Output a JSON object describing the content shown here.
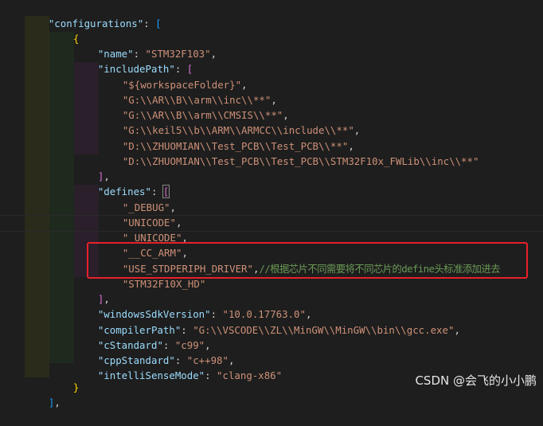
{
  "lines": [
    [
      "\"configurations\"",
      ": ",
      "["
    ],
    [
      "{"
    ],
    [
      "\"name\"",
      ": ",
      "\"STM32F103\"",
      ","
    ],
    [
      "\"includePath\"",
      ": ",
      "["
    ],
    [
      "\"${workspaceFolder}\"",
      ","
    ],
    [
      "\"G:\\\\AR\\\\B\\\\arm\\\\inc\\\\**\"",
      ","
    ],
    [
      "\"G:\\\\AR\\\\B\\\\arm\\\\CMSIS\\\\**\"",
      ","
    ],
    [
      "\"G:\\\\keil5\\\\b\\\\ARM\\\\ARMCC\\\\include\\\\**\"",
      ","
    ],
    [
      "\"D:\\\\ZHUOMIAN\\\\Test_PCB\\\\Test_PCB\\\\**\"",
      ","
    ],
    [
      "\"D:\\\\ZHUOMIAN\\\\Test_PCB\\\\Test_PCB\\\\STM32F10x_FWLib\\\\inc\\\\**\""
    ],
    [
      "]",
      ","
    ],
    [
      "\"defines\"",
      ": ",
      "["
    ],
    [
      "\"_DEBUG\"",
      ","
    ],
    [
      "\"UNICODE\"",
      ","
    ],
    [
      "\"_UNICODE\"",
      ","
    ],
    [
      "\"__CC_ARM\"",
      ","
    ],
    [
      "\"USE_STDPERIPH_DRIVER\"",
      ",",
      "//根据芯片不同需要将不同芯片的define头标准添加进去"
    ],
    [
      "\"STM32F10X_HD\""
    ],
    [
      "]",
      ","
    ],
    [
      "\"windowsSdkVersion\"",
      ": ",
      "\"10.0.17763.0\"",
      ","
    ],
    [
      "\"compilerPath\"",
      ": ",
      "\"G:\\\\VSCODE\\\\ZL\\\\MinGW\\\\MinGW\\\\bin\\\\gcc.exe\"",
      ","
    ],
    [
      "\"cStandard\"",
      ": ",
      "\"c99\"",
      ","
    ],
    [
      "\"cppStandard\"",
      ": ",
      "\"c++98\"",
      ","
    ],
    [
      "\"intelliSenseMode\"",
      ": ",
      "\"clang-x86\""
    ],
    [
      "}"
    ],
    [
      "]",
      ","
    ]
  ],
  "watermark": "CSDN @会飞的小小鹏"
}
